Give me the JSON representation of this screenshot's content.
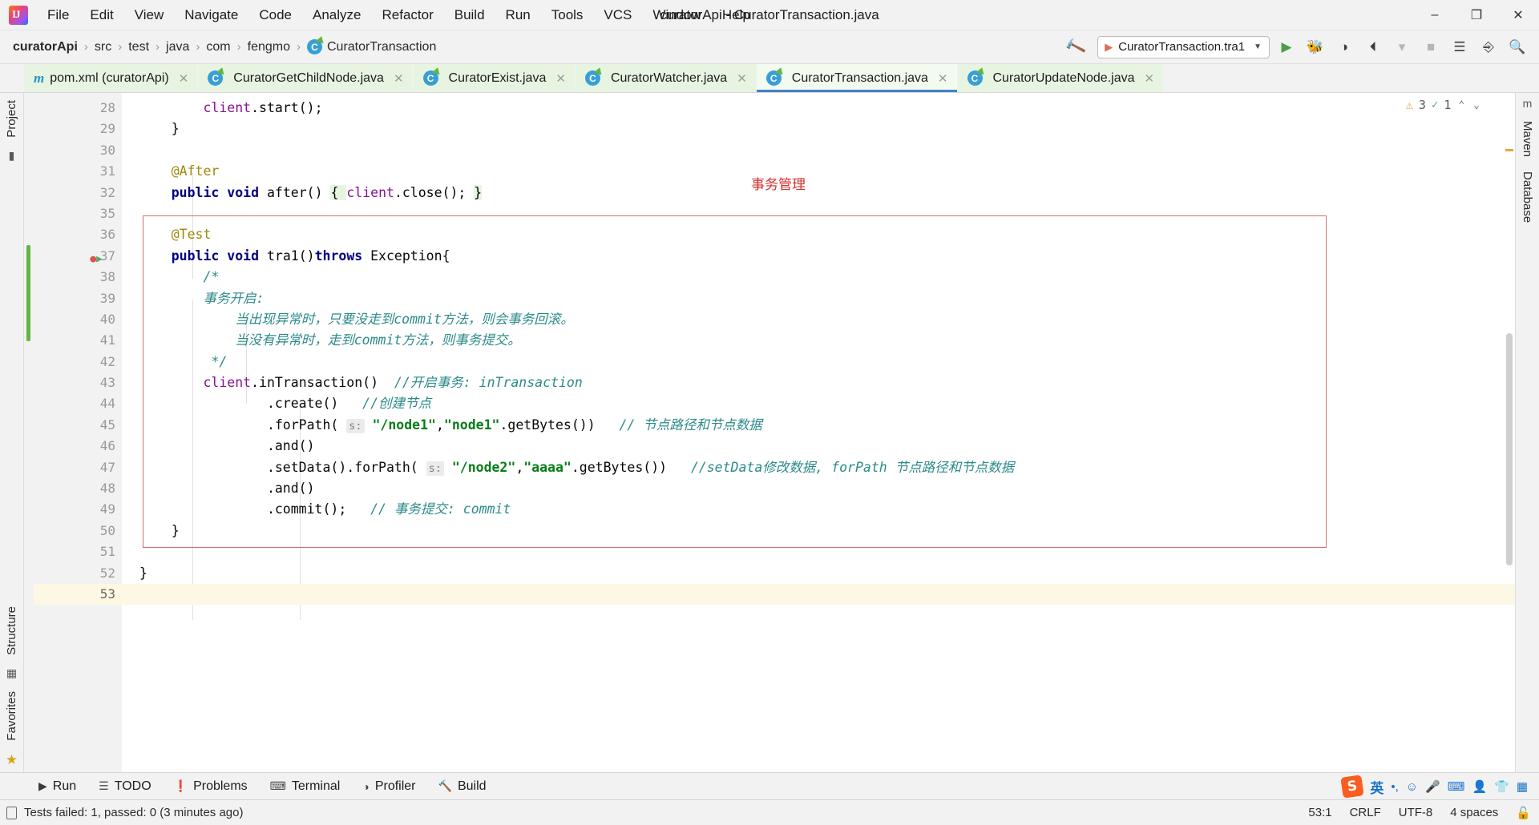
{
  "window": {
    "title": "curatorApi - CuratorTransaction.java",
    "minimize_label": "–",
    "maximize_label": "❐",
    "close_label": "✕",
    "logo_letters": "IJ"
  },
  "menu": [
    {
      "label": "File"
    },
    {
      "label": "Edit"
    },
    {
      "label": "View"
    },
    {
      "label": "Navigate"
    },
    {
      "label": "Code"
    },
    {
      "label": "Analyze"
    },
    {
      "label": "Refactor"
    },
    {
      "label": "Build"
    },
    {
      "label": "Run"
    },
    {
      "label": "Tools"
    },
    {
      "label": "VCS"
    },
    {
      "label": "Window"
    },
    {
      "label": "Help"
    }
  ],
  "breadcrumb": {
    "items": [
      "curatorApi",
      "src",
      "test",
      "java",
      "com",
      "fengmo"
    ],
    "separator": "›",
    "last": "CuratorTransaction",
    "class_badge": "C"
  },
  "navbar": {
    "hammer_icon": "build-hammer-icon",
    "run_config": "CuratorTransaction.tra1",
    "run_config_icon": "junit-run-icon",
    "dropdown_caret": "▼",
    "run_icon": "▶",
    "debug_icon": "ὁE",
    "coverage_icon": "◑",
    "profile_icon": "◴",
    "stop_icon": "■",
    "search_icon": "⌕"
  },
  "tabs": [
    {
      "label": "pom.xml (curatorApi)",
      "icon": "maven-icon",
      "active": false
    },
    {
      "label": "CuratorGetChildNode.java",
      "icon": "java-class-icon",
      "active": false
    },
    {
      "label": "CuratorExist.java",
      "icon": "java-class-icon",
      "active": false
    },
    {
      "label": "CuratorWatcher.java",
      "icon": "java-class-icon",
      "active": false
    },
    {
      "label": "CuratorTransaction.java",
      "icon": "java-class-icon",
      "active": true
    },
    {
      "label": "CuratorUpdateNode.java",
      "icon": "java-class-icon",
      "active": false
    }
  ],
  "tab_close_glyph": "✕",
  "left_tool_labels": [
    "Project",
    "Structure",
    "Favorites"
  ],
  "right_tool_labels": [
    "Maven",
    "Database"
  ],
  "editor": {
    "line_numbers": [
      28,
      29,
      30,
      31,
      32,
      35,
      36,
      37,
      38,
      39,
      40,
      41,
      42,
      43,
      44,
      45,
      46,
      47,
      48,
      49,
      50,
      51,
      52,
      53
    ],
    "current_line": 53,
    "annotation_label": "事务管理",
    "lines": [
      {
        "n": 28,
        "tokens": [
          {
            "t": "        ",
            "c": "plain"
          },
          {
            "t": "client",
            "c": "fld"
          },
          {
            "t": ".",
            "c": "plain"
          },
          {
            "t": "start();",
            "c": "plain"
          }
        ]
      },
      {
        "n": 29,
        "tokens": [
          {
            "t": "    }",
            "c": "plain"
          }
        ]
      },
      {
        "n": 30,
        "tokens": []
      },
      {
        "n": 31,
        "tokens": [
          {
            "t": "    @After",
            "c": "anno"
          }
        ]
      },
      {
        "n": 32,
        "tokens": [
          {
            "t": "    ",
            "c": "plain"
          },
          {
            "t": "public void ",
            "c": "kw"
          },
          {
            "t": "after() ",
            "c": "plain"
          },
          {
            "t": "{ ",
            "c": "hl"
          },
          {
            "t": "client",
            "c": "fld"
          },
          {
            "t": ".close(); ",
            "c": "plain"
          },
          {
            "t": "}",
            "c": "hl"
          }
        ]
      },
      {
        "n": 35,
        "tokens": []
      },
      {
        "n": 36,
        "tokens": [
          {
            "t": "    @Test",
            "c": "anno"
          }
        ]
      },
      {
        "n": 37,
        "tokens": [
          {
            "t": "    ",
            "c": "plain"
          },
          {
            "t": "public void ",
            "c": "kw"
          },
          {
            "t": "tra1()",
            "c": "plain"
          },
          {
            "t": "throws ",
            "c": "kw"
          },
          {
            "t": "Exception{",
            "c": "plain"
          }
        ]
      },
      {
        "n": 38,
        "tokens": [
          {
            "t": "        /*",
            "c": "cmt"
          }
        ]
      },
      {
        "n": 39,
        "tokens": [
          {
            "t": "        事务开启:",
            "c": "cmt"
          }
        ]
      },
      {
        "n": 40,
        "tokens": [
          {
            "t": "            当出现异常时，只要没走到commit方法，则会事务回滚。",
            "c": "cmt"
          }
        ]
      },
      {
        "n": 41,
        "tokens": [
          {
            "t": "            当没有异常时，走到commit方法，则事务提交。",
            "c": "cmt"
          }
        ]
      },
      {
        "n": 42,
        "tokens": [
          {
            "t": "         */",
            "c": "cmt"
          }
        ]
      },
      {
        "n": 43,
        "tokens": [
          {
            "t": "        ",
            "c": "plain"
          },
          {
            "t": "client",
            "c": "fld"
          },
          {
            "t": ".inTransaction()  ",
            "c": "plain"
          },
          {
            "t": "//开启事务: inTransaction",
            "c": "cmt"
          }
        ]
      },
      {
        "n": 44,
        "tokens": [
          {
            "t": "                .create()   ",
            "c": "plain"
          },
          {
            "t": "//创建节点",
            "c": "cmt"
          }
        ]
      },
      {
        "n": 45,
        "tokens": [
          {
            "t": "                .forPath( ",
            "c": "plain"
          },
          {
            "t": "s:",
            "c": "hint"
          },
          {
            "t": " ",
            "c": "plain"
          },
          {
            "t": "\"/node1\"",
            "c": "str"
          },
          {
            "t": ",",
            "c": "plain"
          },
          {
            "t": "\"node1\"",
            "c": "str"
          },
          {
            "t": ".getBytes())   ",
            "c": "plain"
          },
          {
            "t": "// 节点路径和节点数据",
            "c": "cmt"
          }
        ]
      },
      {
        "n": 46,
        "tokens": [
          {
            "t": "                .and()",
            "c": "plain"
          }
        ]
      },
      {
        "n": 47,
        "tokens": [
          {
            "t": "                .setData().forPath( ",
            "c": "plain"
          },
          {
            "t": "s:",
            "c": "hint"
          },
          {
            "t": " ",
            "c": "plain"
          },
          {
            "t": "\"/node2\"",
            "c": "str"
          },
          {
            "t": ",",
            "c": "plain"
          },
          {
            "t": "\"aaaa\"",
            "c": "str"
          },
          {
            "t": ".getBytes())   ",
            "c": "plain"
          },
          {
            "t": "//setData修改数据, forPath 节点路径和节点数据",
            "c": "cmt"
          }
        ]
      },
      {
        "n": 48,
        "tokens": [
          {
            "t": "                .and()",
            "c": "plain"
          }
        ]
      },
      {
        "n": 49,
        "tokens": [
          {
            "t": "                .commit();   ",
            "c": "plain"
          },
          {
            "t": "// 事务提交: commit",
            "c": "cmt"
          }
        ]
      },
      {
        "n": 50,
        "tokens": [
          {
            "t": "    }",
            "c": "plain"
          }
        ]
      },
      {
        "n": 51,
        "tokens": []
      },
      {
        "n": 52,
        "tokens": [
          {
            "t": "}",
            "c": "plain"
          }
        ]
      },
      {
        "n": 53,
        "tokens": []
      }
    ]
  },
  "inspection": {
    "warning_count": "3",
    "ok_count": "1",
    "warning_icon": "⚠",
    "ok_icon": "✓",
    "up_chevron": "⌃",
    "down_chevron": "⌄"
  },
  "bottom_tools": [
    {
      "label": "Run",
      "icon": "run-play-icon"
    },
    {
      "label": "TODO",
      "icon": "todo-list-icon"
    },
    {
      "label": "Problems",
      "icon": "problems-icon"
    },
    {
      "label": "Terminal",
      "icon": "terminal-icon"
    },
    {
      "label": "Profiler",
      "icon": "profiler-icon"
    },
    {
      "label": "Build",
      "icon": "build-hammer-icon"
    }
  ],
  "statusbar": {
    "message": "Tests failed: 1, passed: 0 (3 minutes ago)",
    "message_icon": "document-icon",
    "caret_position": "53:1",
    "line_separator": "CRLF",
    "encoding": "UTF-8",
    "indent": "4 spaces",
    "lock_icon": "🔓"
  },
  "ime_tray": {
    "sogou_letter": "S",
    "items": [
      {
        "name": "chinese-english-toggle",
        "glyph": "英"
      },
      {
        "name": "punctuation-toggle",
        "glyph": "•,"
      },
      {
        "name": "emoji-icon",
        "glyph": "☺"
      },
      {
        "name": "microphone-icon",
        "glyph": "Ἲ4"
      },
      {
        "name": "keyboard-icon",
        "glyph": "⌨"
      },
      {
        "name": "user-icon",
        "glyph": "὆4"
      },
      {
        "name": "skin-icon",
        "glyph": "ὅ5"
      },
      {
        "name": "toolbox-icon",
        "glyph": "▦"
      }
    ]
  },
  "colors": {
    "accent": "#4083c9",
    "tab_bg": "#e8f4e2",
    "active_tab_bg": "#f3fbef",
    "comment": "#2c8a8a",
    "string": "#067d17",
    "keyword": "#000080",
    "annotation_red": "#d03030",
    "redbox_border": "#d96c6c",
    "current_line": "#fcf8e3"
  }
}
